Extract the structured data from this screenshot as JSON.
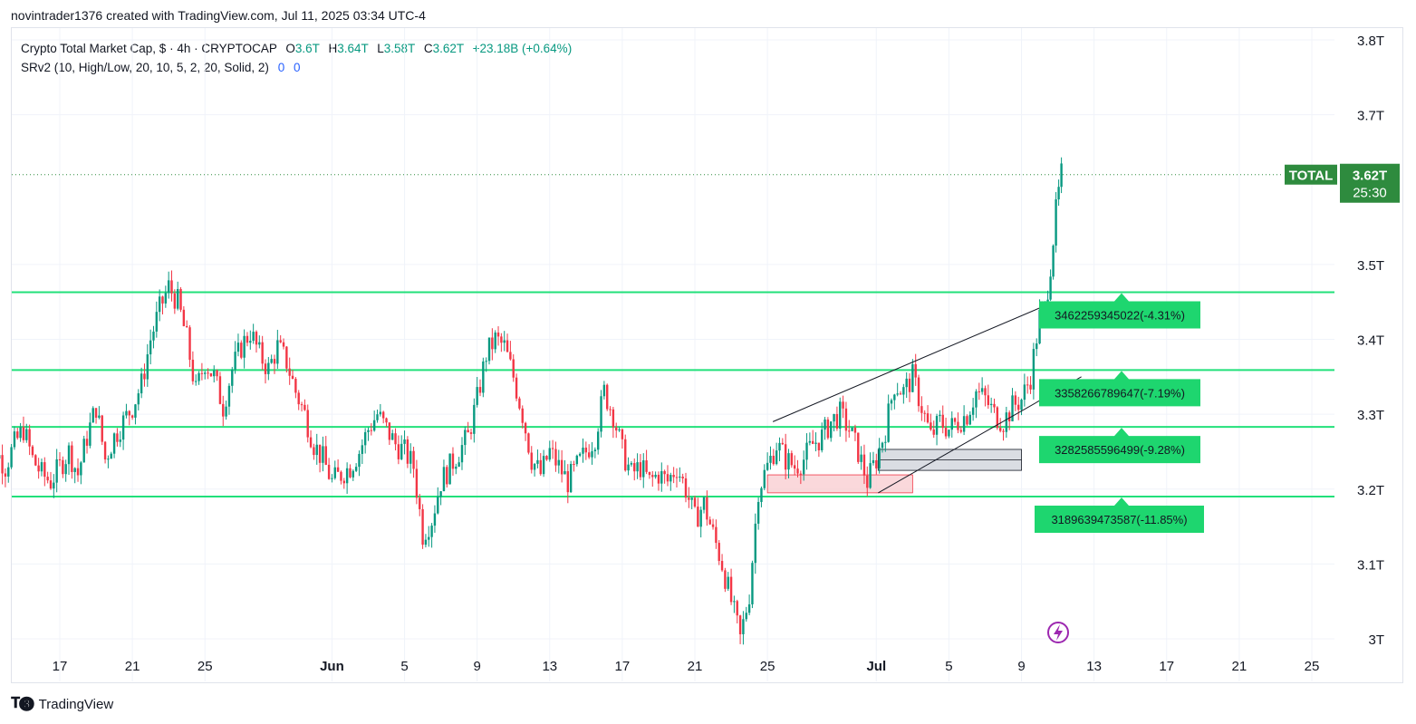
{
  "header": {
    "attribution": "novintrader1376 created with TradingView.com, Jul 11, 2025 03:34 UTC-4"
  },
  "legend": {
    "title": "Crypto Total Market Cap, $ · 4h · CRYPTOCAP",
    "o_label": "O",
    "o_value": "3.6T",
    "h_label": "H",
    "h_value": "3.64T",
    "l_label": "L",
    "l_value": "3.58T",
    "c_label": "C",
    "c_value": "3.62T",
    "change": "+23.18B (+0.64%)",
    "indicator": "SRv2 (10, High/Low, 20, 10, 5, 2, 20, Solid, 2)",
    "ind_v1": "0",
    "ind_v2": "0"
  },
  "footer": {
    "brand": "TradingView"
  },
  "colors": {
    "up": "#089981",
    "down": "#f23645",
    "level": "#22e07a",
    "label_bg": "#1ed66f",
    "price_tag": "#2e8b3e",
    "grid": "#f0f3fa"
  },
  "chart_data": {
    "type": "candlestick",
    "symbol": "TOTAL",
    "ylim": [
      2.99,
      3.84
    ],
    "yticks": [
      "3T",
      "3.1T",
      "3.2T",
      "3.3T",
      "3.4T",
      "3.5T",
      "3.7T",
      "3.8T"
    ],
    "ytick_values": [
      3.0,
      3.1,
      3.2,
      3.3,
      3.4,
      3.5,
      3.7,
      3.8
    ],
    "xticks": [
      "17",
      "21",
      "25",
      "Jun",
      "5",
      "9",
      "13",
      "17",
      "21",
      "25",
      "Jul",
      "5",
      "9",
      "13",
      "17",
      "21",
      "25"
    ],
    "xtick_days": [
      17,
      21,
      25,
      32,
      36,
      40,
      44,
      48,
      52,
      56,
      62,
      66,
      70,
      74,
      78,
      82,
      86
    ],
    "x_start_day": 12.4,
    "x_end_day": 87,
    "last_price": "3.62T",
    "last_price_value": 3.62,
    "countdown": "25:30",
    "closes": [
      {
        "d": 12.5,
        "c": 3.29
      },
      {
        "d": 13,
        "c": 3.27
      },
      {
        "d": 13.5,
        "c": 3.25
      },
      {
        "d": 14,
        "c": 3.23
      },
      {
        "d": 14.5,
        "c": 3.26
      },
      {
        "d": 15,
        "c": 3.28
      },
      {
        "d": 15.5,
        "c": 3.24
      },
      {
        "d": 16,
        "c": 3.22
      },
      {
        "d": 16.5,
        "c": 3.21
      },
      {
        "d": 17,
        "c": 3.23
      },
      {
        "d": 17.5,
        "c": 3.25
      },
      {
        "d": 18,
        "c": 3.22
      },
      {
        "d": 18.5,
        "c": 3.27
      },
      {
        "d": 19,
        "c": 3.31
      },
      {
        "d": 19.5,
        "c": 3.24
      },
      {
        "d": 20,
        "c": 3.27
      },
      {
        "d": 20.5,
        "c": 3.29
      },
      {
        "d": 21,
        "c": 3.31
      },
      {
        "d": 21.5,
        "c": 3.34
      },
      {
        "d": 22,
        "c": 3.4
      },
      {
        "d": 22.5,
        "c": 3.44
      },
      {
        "d": 23,
        "c": 3.47
      },
      {
        "d": 23.5,
        "c": 3.45
      },
      {
        "d": 24,
        "c": 3.4
      },
      {
        "d": 24.5,
        "c": 3.33
      },
      {
        "d": 25,
        "c": 3.37
      },
      {
        "d": 25.5,
        "c": 3.35
      },
      {
        "d": 26,
        "c": 3.31
      },
      {
        "d": 26.5,
        "c": 3.36
      },
      {
        "d": 27,
        "c": 3.39
      },
      {
        "d": 27.5,
        "c": 3.41
      },
      {
        "d": 28,
        "c": 3.38
      },
      {
        "d": 28.5,
        "c": 3.36
      },
      {
        "d": 29,
        "c": 3.39
      },
      {
        "d": 29.5,
        "c": 3.37
      },
      {
        "d": 30,
        "c": 3.33
      },
      {
        "d": 30.5,
        "c": 3.3
      },
      {
        "d": 31,
        "c": 3.26
      },
      {
        "d": 31.5,
        "c": 3.24
      },
      {
        "d": 32,
        "c": 3.21
      },
      {
        "d": 32.5,
        "c": 3.22
      },
      {
        "d": 33,
        "c": 3.23
      },
      {
        "d": 33.5,
        "c": 3.25
      },
      {
        "d": 34,
        "c": 3.28
      },
      {
        "d": 34.5,
        "c": 3.3
      },
      {
        "d": 35,
        "c": 3.28
      },
      {
        "d": 35.5,
        "c": 3.26
      },
      {
        "d": 36,
        "c": 3.25
      },
      {
        "d": 36.5,
        "c": 3.23
      },
      {
        "d": 37,
        "c": 3.14
      },
      {
        "d": 37.5,
        "c": 3.16
      },
      {
        "d": 38,
        "c": 3.21
      },
      {
        "d": 38.5,
        "c": 3.23
      },
      {
        "d": 39,
        "c": 3.25
      },
      {
        "d": 39.5,
        "c": 3.27
      },
      {
        "d": 40,
        "c": 3.32
      },
      {
        "d": 40.5,
        "c": 3.38
      },
      {
        "d": 41,
        "c": 3.4
      },
      {
        "d": 41.5,
        "c": 3.39
      },
      {
        "d": 42,
        "c": 3.35
      },
      {
        "d": 42.5,
        "c": 3.3
      },
      {
        "d": 43,
        "c": 3.24
      },
      {
        "d": 43.5,
        "c": 3.22
      },
      {
        "d": 44,
        "c": 3.25
      },
      {
        "d": 44.5,
        "c": 3.23
      },
      {
        "d": 45,
        "c": 3.21
      },
      {
        "d": 45.5,
        "c": 3.23
      },
      {
        "d": 46,
        "c": 3.25
      },
      {
        "d": 46.5,
        "c": 3.27
      },
      {
        "d": 47,
        "c": 3.33
      },
      {
        "d": 47.5,
        "c": 3.3
      },
      {
        "d": 48,
        "c": 3.25
      },
      {
        "d": 48.5,
        "c": 3.22
      },
      {
        "d": 49,
        "c": 3.23
      },
      {
        "d": 49.5,
        "c": 3.21
      },
      {
        "d": 50,
        "c": 3.22
      },
      {
        "d": 50.5,
        "c": 3.21
      },
      {
        "d": 51,
        "c": 3.23
      },
      {
        "d": 51.5,
        "c": 3.2
      },
      {
        "d": 52,
        "c": 3.16
      },
      {
        "d": 52.5,
        "c": 3.18
      },
      {
        "d": 53,
        "c": 3.14
      },
      {
        "d": 53.5,
        "c": 3.1
      },
      {
        "d": 54,
        "c": 3.05
      },
      {
        "d": 54.5,
        "c": 3.0
      },
      {
        "d": 55,
        "c": 3.06
      },
      {
        "d": 55.5,
        "c": 3.2
      },
      {
        "d": 56,
        "c": 3.23
      },
      {
        "d": 56.5,
        "c": 3.26
      },
      {
        "d": 57,
        "c": 3.24
      },
      {
        "d": 57.5,
        "c": 3.23
      },
      {
        "d": 58,
        "c": 3.24
      },
      {
        "d": 58.5,
        "c": 3.26
      },
      {
        "d": 59,
        "c": 3.27
      },
      {
        "d": 59.5,
        "c": 3.29
      },
      {
        "d": 60,
        "c": 3.3
      },
      {
        "d": 60.5,
        "c": 3.28
      },
      {
        "d": 61,
        "c": 3.25
      },
      {
        "d": 61.5,
        "c": 3.21
      },
      {
        "d": 62,
        "c": 3.24
      },
      {
        "d": 62.5,
        "c": 3.28
      },
      {
        "d": 63,
        "c": 3.34
      },
      {
        "d": 63.5,
        "c": 3.33
      },
      {
        "d": 64,
        "c": 3.35
      },
      {
        "d": 64.5,
        "c": 3.31
      },
      {
        "d": 65,
        "c": 3.27
      },
      {
        "d": 65.5,
        "c": 3.29
      },
      {
        "d": 66,
        "c": 3.28
      },
      {
        "d": 66.5,
        "c": 3.29
      },
      {
        "d": 67,
        "c": 3.3
      },
      {
        "d": 67.5,
        "c": 3.33
      },
      {
        "d": 68,
        "c": 3.32
      },
      {
        "d": 68.5,
        "c": 3.3
      },
      {
        "d": 69,
        "c": 3.29
      },
      {
        "d": 69.5,
        "c": 3.31
      },
      {
        "d": 70,
        "c": 3.32
      },
      {
        "d": 70.5,
        "c": 3.35
      },
      {
        "d": 71,
        "c": 3.43
      },
      {
        "d": 71.3,
        "c": 3.44
      },
      {
        "d": 71.6,
        "c": 3.5
      },
      {
        "d": 71.9,
        "c": 3.57
      },
      {
        "d": 72.2,
        "c": 3.62
      }
    ]
  },
  "levels": [
    {
      "value": 3.463,
      "label": "3462259345022(-4.31%)"
    },
    {
      "value": 3.359,
      "label": "3358266789647(-7.19%)"
    },
    {
      "value": 3.283,
      "label": "3282585596499(-9.28%)"
    },
    {
      "value": 3.19,
      "label": "3189639473587(-11.85%)"
    }
  ],
  "axis_label": "TOTAL"
}
